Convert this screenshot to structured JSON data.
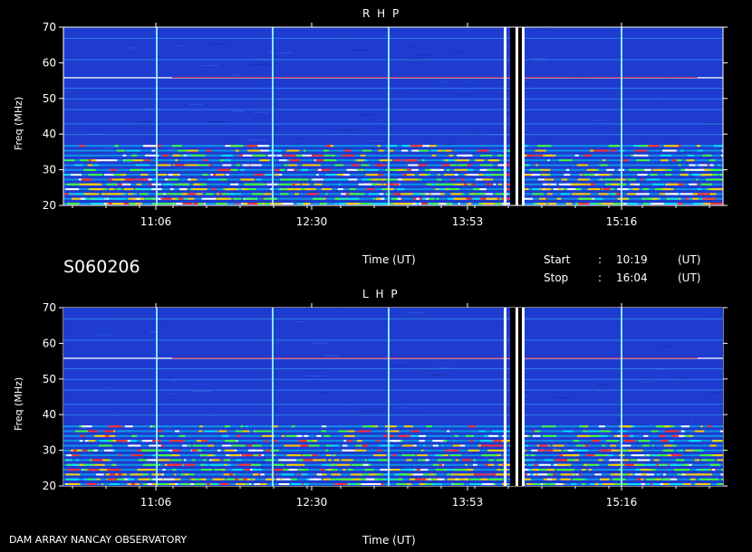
{
  "chart_data": [
    {
      "type": "heatmap",
      "title": "R H P",
      "ylabel": "Freq (MHz)",
      "xlabel": "Time (UT)",
      "y_ticks": [
        "20",
        "30",
        "40",
        "50",
        "60",
        "70"
      ],
      "x_ticks": [
        "11:06",
        "12:30",
        "13:53",
        "15:16"
      ],
      "ylim": [
        20,
        70
      ]
    },
    {
      "type": "heatmap",
      "title": "L H P",
      "ylabel": "Freq (MHz)",
      "xlabel": "Time (UT)",
      "y_ticks": [
        "20",
        "30",
        "40",
        "50",
        "60",
        "70"
      ],
      "x_ticks": [
        "11:06",
        "12:30",
        "13:53",
        "15:16"
      ],
      "ylim": [
        20,
        70
      ]
    }
  ],
  "info": {
    "session_id": "S060206",
    "start_label": "Start",
    "start_sep": ":",
    "start_time": "10:19",
    "start_unit": "(UT)",
    "stop_label": "Stop",
    "stop_sep": ":",
    "stop_time": "16:04",
    "stop_unit": "(UT)"
  },
  "footer": {
    "observatory": "DAM ARRAY  NANCAY OBSERVATORY",
    "time_label": "Time (UT)"
  },
  "colors": {
    "background": "#000000",
    "spectrum_base": "#1e3ccf",
    "axis": "#ffffff"
  }
}
